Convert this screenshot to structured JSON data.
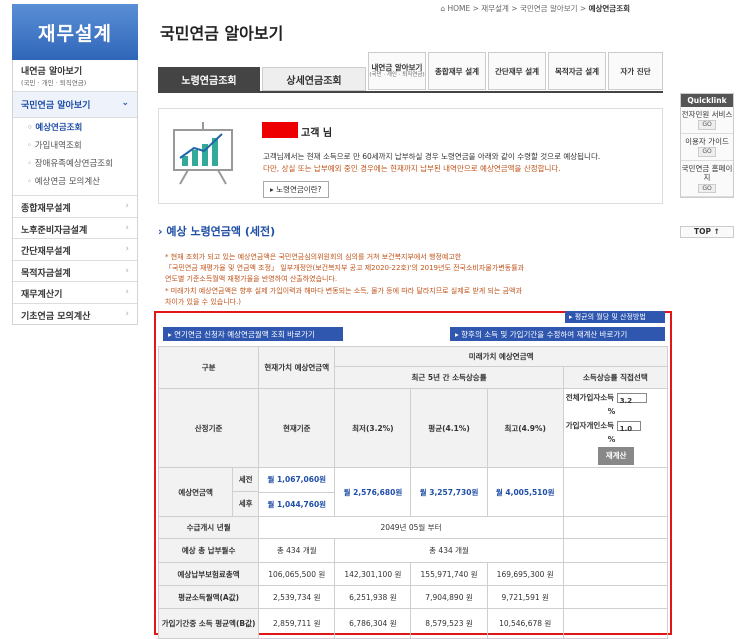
{
  "sidebar": {
    "logo": "재무설계",
    "top_title": "내연금 알아보기",
    "top_sub": "(국민 · 개인 · 퇴직연금)",
    "active": "국민연금 알아보기",
    "subitems": [
      "예상연금조회",
      "가입내역조회",
      "장애유족예상연금조회",
      "예상연금 모의계산"
    ],
    "items": [
      "종합재무설계",
      "노후준비자금설계",
      "간단재무설계",
      "목적자금설계",
      "재무계산기",
      "기초연금 모의계산"
    ]
  },
  "breadcrumb": {
    "path": "HOME > 재무설계 > 국민연금 알아보기 > ",
    "current": "예상연금조회"
  },
  "page_title": "국민연금 알아보기",
  "tabs": {
    "a": "노령연금조회",
    "b": "상세연금조회"
  },
  "menu_tabs": [
    {
      "label": "내연금 알아보기",
      "sub": "(국민 · 개인 · 퇴직연금)"
    },
    {
      "label": "종합재무 설계",
      "sub": ""
    },
    {
      "label": "간단재무 설계",
      "sub": ""
    },
    {
      "label": "목적자금 설계",
      "sub": ""
    },
    {
      "label": "자가 진단",
      "sub": ""
    }
  ],
  "info": {
    "customer_suffix": "고객 님",
    "line1": "고객님께서는 현재 소득으로 만 60세까지 납부하실 경우 노령연금을 아래와 같이 수령할 것으로 예상됩니다.",
    "line2": "다만, 상실 또는 납부예외 중인 경우에는 현재까지 납부된 내역만으로 예상연금액을 산정합니다.",
    "button": "노령연금이란?"
  },
  "section_title": "예상 노령연금액 (세전)",
  "notes": [
    "* 현재 조회가 되고 있는 예상연금액은 국민연금심의위원회의 심의를 거쳐 보건복지부에서 행정예고한",
    "  「국민연금 재평가율 및 연금액 조정」 일부개정안(보건복지부 공고 제2020-22호)'의 2019년도 전국소비자물가변동률과",
    "  연도별 기준소득월액 재평가율을 반영하여 산출하였습니다.",
    "* 미래가치 예상연금액은 향후 실제 가입이력과 해마다 변동되는 소득, 물가 등에 따라 달라지므로 실제로 받게 되는 금액과",
    "  차이가 있을 수 있습니다.)"
  ],
  "links": {
    "left": "▸ 연기연금 신청자 예상연금월액 조회 바로가기",
    "right": "▸ 향후의 소득 및 가입기간을 수정하여 재계산 바로가기",
    "top": "▸ 평균의 월당 및 산정방법"
  },
  "table": {
    "h_gubun": "구분",
    "h_current": "현재가치 예상연금액",
    "h_future": "미래가치 예상연금액",
    "h_recent": "최근 5년 간 소득상승률",
    "h_direct": "소득상승률 직접선택",
    "h_basis": "산정기준",
    "h_curbasis": "현재기준",
    "h_low": "최저(3.2%)",
    "h_avg": "평균(4.1%)",
    "h_high": "최고(4.9%)",
    "calc": {
      "label1": "전체가입자소득",
      "select_value": "3.2",
      "pct": "%",
      "label2": "가입자개인소득",
      "input_value": "1.0",
      "button": "재계산"
    },
    "r_pension": "예상연금액",
    "pre_tax": "세전",
    "post_tax": "세후",
    "cur_pre": "월 1,067,060원",
    "cur_post": "월 1,044,760원",
    "low": "월 2,576,680원",
    "avg": "월 3,257,730원",
    "high": "월 4,005,510원",
    "r_start": "수급개시 년월",
    "start_val": "2049년 05월 부터",
    "r_months": "예상 총 납부월수",
    "months_cur": "총 434 개월",
    "months_fut": "총 434 개월",
    "r_total": "예상납부보험료총액",
    "total": [
      "106,065,500 원",
      "142,301,100 원",
      "155,971,740 원",
      "169,695,300 원"
    ],
    "r_avalue": "평균소득월액(A값)",
    "avalue": [
      "2,539,734 원",
      "6,251,938 원",
      "7,904,890 원",
      "9,721,591 원"
    ],
    "r_bvalue": "가입기간중 소득 평균액(B값)",
    "bvalue": [
      "2,859,711 원",
      "6,786,304 원",
      "8,579,523 원",
      "10,546,678 원"
    ]
  },
  "quicklink": {
    "title": "Quicklink",
    "items": [
      "전자민원 서비스",
      "이용자 가이드",
      "국민연금 홈페이지"
    ],
    "go": "GO",
    "top": "TOP ↑"
  }
}
